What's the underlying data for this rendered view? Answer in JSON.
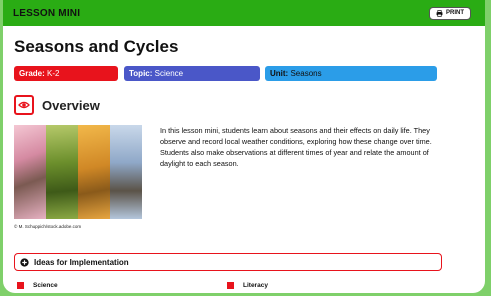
{
  "header": {
    "title": "LESSON MINI",
    "print_label": "PRINT"
  },
  "lesson": {
    "title": "Seasons and Cycles",
    "grade": {
      "label": "Grade:",
      "value": "K-2"
    },
    "topic": {
      "label": "Topic:",
      "value": "Science"
    },
    "unit": {
      "label": "Unit:",
      "value": "Seasons"
    }
  },
  "overview": {
    "heading": "Overview",
    "image_credit": "© M. Schuppich/stock.adobe.com",
    "text": "In this lesson mini, students learn about seasons and their effects on daily life. They observe and record local weather conditions, exploring how these change over time. Students also make observations at different times of year and relate the amount of daylight to each season."
  },
  "ideas": {
    "label": "Ideas for Implementation",
    "items": [
      "Science",
      "Literacy"
    ]
  },
  "colors": {
    "accent_green": "#2aac14",
    "accent_red": "#e8131c",
    "topic_blue": "#4a57c8",
    "unit_blue": "#2b9de8"
  },
  "icons": {
    "print": "printer-icon",
    "overview": "eye-icon",
    "ideas": "plus-circle-icon"
  }
}
